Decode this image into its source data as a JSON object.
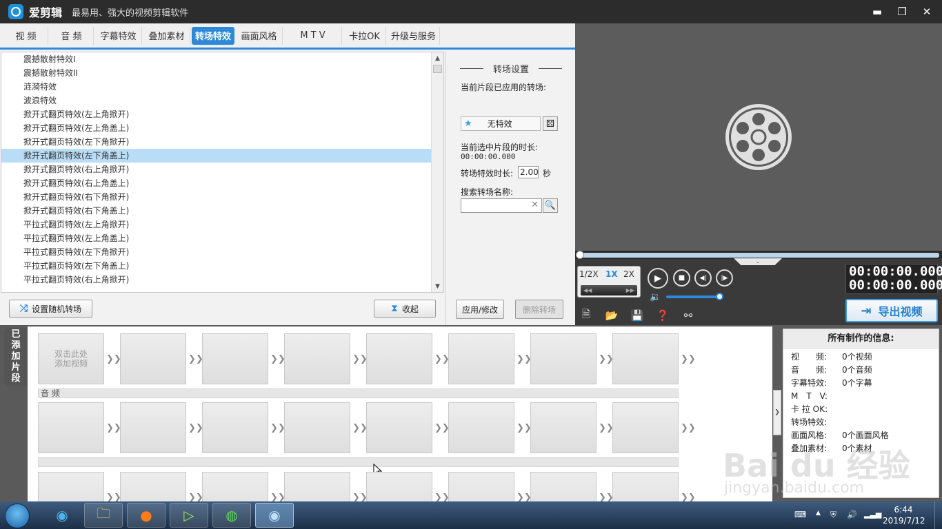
{
  "titlebar": {
    "app_name": "爱剪辑",
    "slogan": "最易用、强大的视频剪辑软件",
    "minimize": "▬",
    "restore": "❐",
    "close": "✕"
  },
  "tabs": [
    {
      "label": "视 频",
      "active": false
    },
    {
      "label": "音 频",
      "active": false
    },
    {
      "label": "字幕特效",
      "active": false
    },
    {
      "label": "叠加素材",
      "active": false
    },
    {
      "label": "转场特效",
      "active": true
    },
    {
      "label": "画面风格",
      "active": false
    },
    {
      "label": "M T V",
      "active": false
    },
    {
      "label": "卡拉OK",
      "active": false
    },
    {
      "label": "升级与服务",
      "active": false
    }
  ],
  "transition_list": {
    "items": [
      "震撼散射特效I",
      "震撼散射特效II",
      "涟漪特效",
      "波浪特效",
      "掀开式翻页特效(左上角掀开)",
      "掀开式翻页特效(左上角盖上)",
      "掀开式翻页特效(左下角掀开)",
      "掀开式翻页特效(左下角盖上)",
      "掀开式翻页特效(右上角掀开)",
      "掀开式翻页特效(右上角盖上)",
      "掀开式翻页特效(右下角掀开)",
      "掀开式翻页特效(右下角盖上)",
      "平拉式翻页特效(左上角掀开)",
      "平拉式翻页特效(左上角盖上)",
      "平拉式翻页特效(左下角掀开)",
      "平拉式翻页特效(左下角盖上)",
      "平拉式翻页特效(右上角掀开)"
    ],
    "selected_index": 7
  },
  "buttons": {
    "random_transition": "设置随机转场",
    "collapse": "收起",
    "apply": "应用/修改",
    "delete": "删除转场"
  },
  "settings": {
    "heading": "转场设置",
    "applied_label": "当前片段已应用的转场:",
    "applied_value": "无特效",
    "clip_duration_label": "当前选中片段的时长:",
    "clip_duration_value": "00:00:00.000",
    "effect_duration_label": "转场特效时长:",
    "effect_duration_value": "2.00",
    "effect_duration_unit": "秒",
    "search_label": "搜索转场名称:",
    "search_value": "",
    "clear_glyph": "✕"
  },
  "player": {
    "progress": 0,
    "speeds": [
      "1/2X",
      "1X",
      "2X"
    ],
    "active_speed": "1X",
    "time_current": "00:00:00.000",
    "time_total": "00:00:00.000",
    "volume": 0.93,
    "export_label": "导出视频"
  },
  "timeline": {
    "tab_label": [
      "已",
      "添",
      "加",
      "片",
      "段"
    ],
    "add_video_hint": "双击此处\n添加视频",
    "audio_track_label": "音 频",
    "arrow_glyph": "❯❯"
  },
  "info_panel": {
    "title": "所有制作的信息:",
    "rows": [
      {
        "key": "视　　频:",
        "value": "0个视频"
      },
      {
        "key": "音　　频:",
        "value": "0个音频"
      },
      {
        "key": "字幕特效:",
        "value": "0个字幕"
      },
      {
        "key": "M　T　V:",
        "value": ""
      },
      {
        "key": "卡 拉 OK:",
        "value": ""
      },
      {
        "key": "转场特效:",
        "value": ""
      },
      {
        "key": "画面风格:",
        "value": "0个画面风格"
      },
      {
        "key": "叠加素材:",
        "value": "0个素材"
      }
    ]
  },
  "watermark": {
    "main": "Bai du 经验",
    "sub": "jingyan.baidu.com"
  },
  "taskbar": {
    "time": "6:44",
    "date": "2019/7/12"
  },
  "colors": {
    "accent": "#2e8ad8",
    "selection": "#b9dcf7",
    "preview_bg": "#5c5c5c"
  }
}
